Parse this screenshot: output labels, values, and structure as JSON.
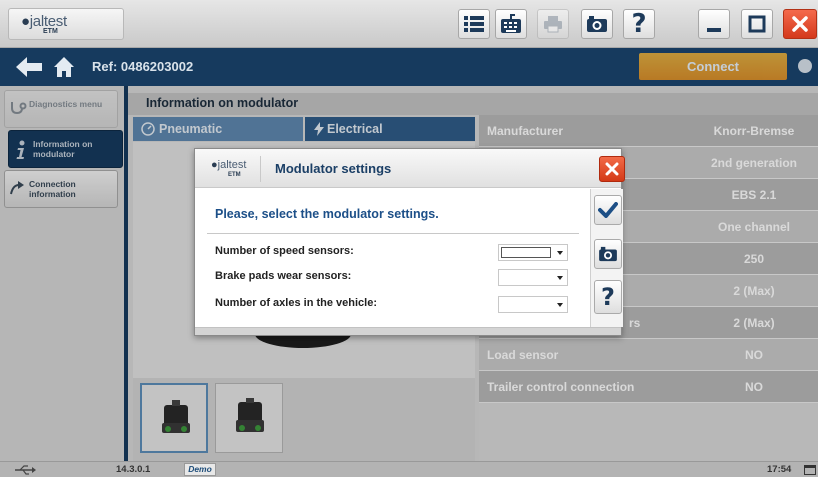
{
  "app": {
    "logo_brand": "jaltest",
    "logo_product": "ETM"
  },
  "toolbar": {
    "list_icon": "list-icon",
    "keyboard_icon": "keyboard-icon",
    "print_icon": "print-icon",
    "camera_icon": "camera-icon",
    "help_label": "?",
    "minimize_icon": "minimize-icon",
    "maximize_icon": "maximize-icon",
    "close_icon": "close-icon"
  },
  "navbar": {
    "ref_label": "Ref: 0486203002",
    "connect_label": "Connect"
  },
  "sidebar": {
    "items": [
      {
        "label": "Diagnostics menu",
        "icon": "stethoscope-icon",
        "state": "disabled"
      },
      {
        "label": "Information on modulator",
        "icon": "info-icon",
        "state": "active"
      },
      {
        "label": "Connection information",
        "icon": "connection-icon",
        "state": "normal"
      }
    ]
  },
  "main": {
    "section_title": "Information on modulator",
    "tabs": [
      {
        "label": "Pneumatic",
        "icon": "gauge-icon"
      },
      {
        "label": "Electrical",
        "icon": "lightning-icon"
      }
    ],
    "info_rows": [
      {
        "label": "Manufacturer",
        "value": "Knorr-Bremse"
      },
      {
        "label": "",
        "value": "2nd generation"
      },
      {
        "label": "",
        "value": "EBS 2.1"
      },
      {
        "label": "",
        "value": "One channel"
      },
      {
        "label": "",
        "value": "250"
      },
      {
        "label": "",
        "value": "2 (Max)"
      },
      {
        "label": "rs",
        "value": "2 (Max)"
      },
      {
        "label": "Load sensor",
        "value": "NO"
      },
      {
        "label": "Trailer control connection",
        "value": "NO"
      }
    ]
  },
  "dialog": {
    "title": "Modulator settings",
    "instruction": "Please, select the modulator settings.",
    "fields": [
      {
        "label": "Number of speed sensors:",
        "value": ""
      },
      {
        "label": "Brake pads wear sensors:",
        "value": ""
      },
      {
        "label": "Number of axles in the vehicle:",
        "value": ""
      }
    ],
    "side_buttons": [
      "check-icon",
      "camera-icon",
      "help-icon"
    ],
    "help_label": "?"
  },
  "statusbar": {
    "version": "14.3.0.1",
    "mode": "Demo",
    "time": "17:54"
  },
  "colors": {
    "navy": "#163a5e",
    "accent_orange": "#f0a020",
    "close_red": "#e0492a",
    "dialog_title": "#1b3f66"
  }
}
